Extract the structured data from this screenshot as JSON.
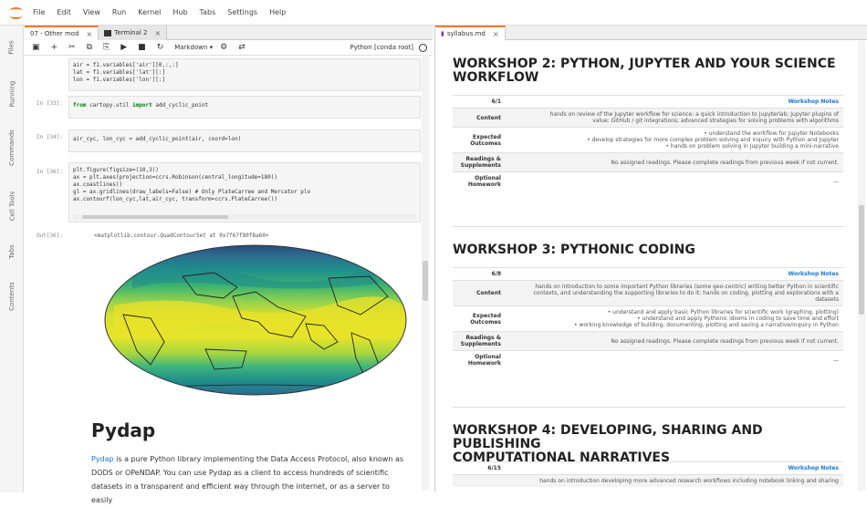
{
  "menu": [
    "File",
    "Edit",
    "View",
    "Run",
    "Kernel",
    "Hub",
    "Tabs",
    "Settings",
    "Help"
  ],
  "sidebar": [
    "Files",
    "Running",
    "Commands",
    "Cell Tools",
    "Tabs",
    "Contents"
  ],
  "left_tabs": [
    {
      "label": "07 - Other mod"
    },
    {
      "label": "Terminal 2"
    }
  ],
  "right_tab": {
    "label": "syllabus.md"
  },
  "toolbar": {
    "celltype": "Markdown",
    "kernel": "Python [conda root]"
  },
  "cells": [
    {
      "prompt": "",
      "lines": [
        "air = f1.variables['air'][0,:,:]",
        "lat = f1.variables['lat'][:]",
        "lon = f1.variables['lon'][:]"
      ]
    },
    {
      "prompt": "In [33]:",
      "lines": [
        "from cartopy.util import add_cyclic_point"
      ]
    },
    {
      "prompt": "In [34]:",
      "lines": [
        "air_cyc, lon_cyc = add_cyclic_point(air, coord=lon)"
      ]
    },
    {
      "prompt": "In [36]:",
      "lines": [
        "plt.figure(figsize=(10,3))",
        "ax = plt.axes(projection=ccrs.Robinson(central_longitude=180))",
        "ax.coastlines()",
        "gl = ax.gridlines(draw_labels=False) # Only PlateCarree and Mercator plo",
        "ax.contourf(lon_cyc,lat,air_cyc, transform=ccrs.PlateCarree())"
      ]
    }
  ],
  "output": {
    "prompt": "Out[36]:",
    "text": "<matplotlib.contour.QuadContourSet at 0x7f67f80f8a60>"
  },
  "markdown": {
    "heading": "Pydap",
    "link": "Pydap",
    "para_lines": [
      " is a pure Python library implementing the Data Access Protocol, also known as",
      "DODS or OPeNDAP. You can use Pydap as a client to access hundreds of scientific",
      "datasets in a transparent and efficient way through the internet, or as a server to easily"
    ]
  },
  "workshops": [
    {
      "title_lines": [
        "WORKSHOP 2: PYTHON, JUPYTER AND YOUR SCIENCE",
        "WORKFLOW"
      ],
      "date": "6/1",
      "notes": "Workshop Notes",
      "content": [
        "hands on review of the Jupyter workflow for science: a quick introduction to Jupyterlab; Jupyter plugins of",
        "value: GitHub / git integrations; advanced strategies for solving problems with algorithms"
      ],
      "outcomes": [
        "• understand the workflow for Jupyter Notebooks",
        "• develop strategies for more complex problem solving and inquiry with Python and Jupyter",
        "• hands on problem solving in Jupyter building a mini-narrative"
      ],
      "readings": "No assigned readings. Please complete readings from previous week if not current.",
      "homework": "—"
    },
    {
      "title_lines": [
        "WORKSHOP 3: PYTHONIC CODING"
      ],
      "date": "6/8",
      "notes": "Workshop Notes",
      "content": [
        "hands on introduction to some important Python libraries (some geo-centric) writing better Python in scientific",
        "contexts, and understanding the supporting libraries to do it; hands on coding, plotting and explorations with a",
        "datasets"
      ],
      "outcomes": [
        "• understand and apply basic Python libraries for scientific work (graphing, plotting)",
        "• understand and apply Pythonic idioms in coding to save time and effort",
        "• working knowledge of building, documenting, plotting and saving a narrative/inquiry in Python"
      ],
      "readings": "No assigned readings. Please complete readings from previous week if not current.",
      "homework": "—"
    },
    {
      "title_lines": [
        "WORKSHOP 4: DEVELOPING, SHARING AND PUBLISHING",
        "COMPUTATIONAL NARRATIVES"
      ],
      "date": "6/15",
      "notes": "Workshop Notes",
      "content": [
        "hands on introduction developing more advanced research workflows including notebook linking and sharing"
      ]
    }
  ],
  "labels": {
    "content": "Content",
    "outcomes": "Expected Outcomes",
    "readings": "Readings & Supplements",
    "homework": "Optional Homework"
  },
  "colors": {
    "accent": "#f37726",
    "link": "#1976d2"
  }
}
